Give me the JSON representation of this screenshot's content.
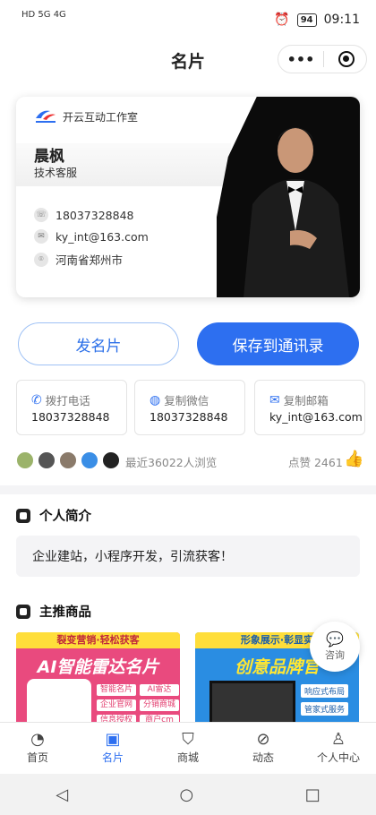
{
  "status": {
    "left": "HD 5G 4G",
    "battery": "94",
    "time": "09:11"
  },
  "nav": {
    "title": "名片",
    "more": "•••"
  },
  "card": {
    "logo_text": "开云互动",
    "company": "开云互动工作室",
    "name": "晨枫",
    "job": "技术客服",
    "phone": "18037328848",
    "email": "ky_int@163.com",
    "location": "河南省郑州市"
  },
  "actions": {
    "send": "发名片",
    "save": "保存到通讯录"
  },
  "contacts": [
    {
      "label": "拨打电话",
      "value": "18037328848",
      "icon": "phone-icon"
    },
    {
      "label": "复制微信",
      "value": "18037328848",
      "icon": "wechat-icon"
    },
    {
      "label": "复制邮箱",
      "value": "ky_int@163.com",
      "icon": "mail-icon"
    }
  ],
  "visitors": {
    "views": "最近36022人浏览",
    "likes": "点赞 2461"
  },
  "intro": {
    "title": "个人简介",
    "text": "企业建站，小程序开发，引流获客！"
  },
  "products": {
    "title": "主推商品",
    "p1": {
      "band": "裂变营销·轻松获客",
      "big": "AI智能雷达名片",
      "tags": [
        "智能名片",
        "AI雷达",
        "企业官网",
        "分销商城",
        "信息授权",
        "商户cm"
      ]
    },
    "p2": {
      "band": "形象展示·彰显实",
      "big": "创意品牌官",
      "tags": [
        "响应式布局",
        "管家式服务"
      ]
    }
  },
  "consult": "咨询",
  "tabs": [
    {
      "label": "首页",
      "icon": "home-icon"
    },
    {
      "label": "名片",
      "icon": "card-icon"
    },
    {
      "label": "商城",
      "icon": "shop-icon"
    },
    {
      "label": "动态",
      "icon": "compass-icon"
    },
    {
      "label": "个人中心",
      "icon": "user-icon"
    }
  ],
  "colors": {
    "accent": "#2d6ff0"
  }
}
